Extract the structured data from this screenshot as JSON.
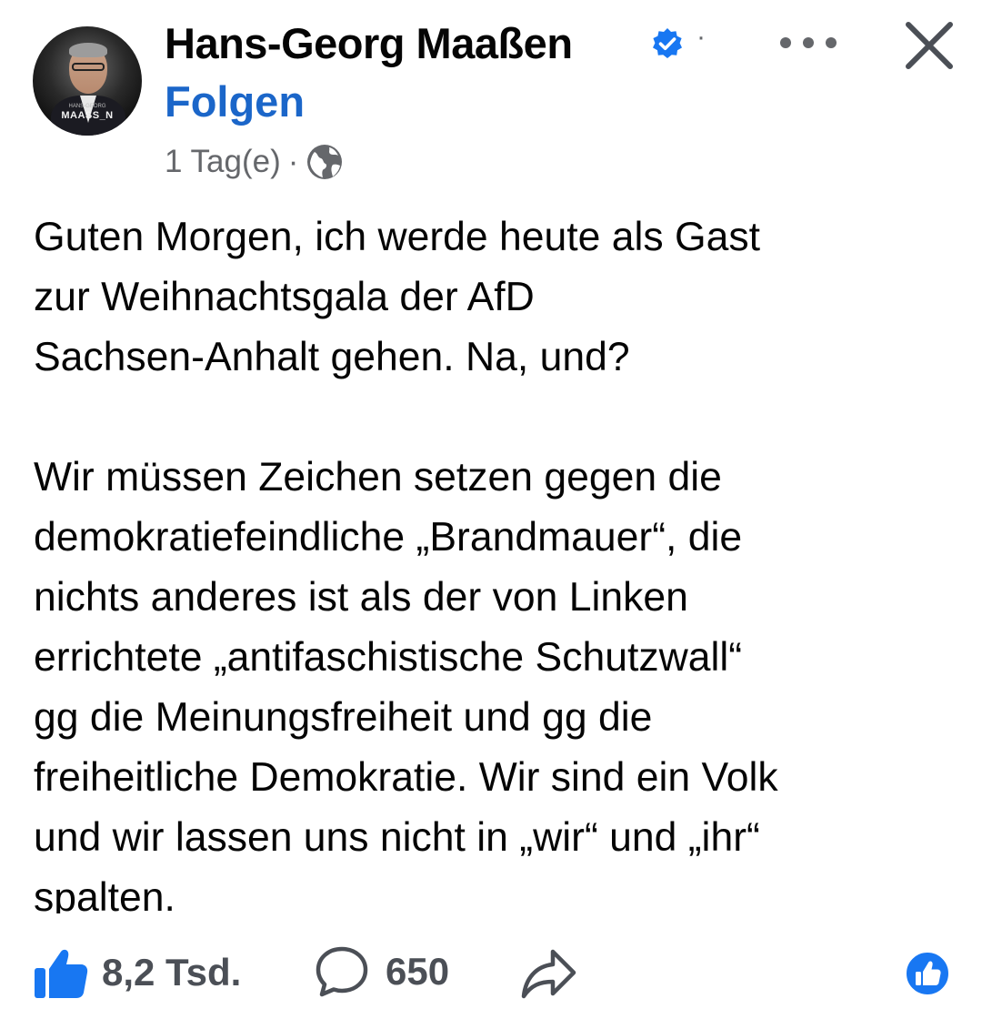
{
  "header": {
    "author_name": "Hans-Georg Maaßen",
    "avatar_brand": "MAASS_N",
    "avatar_brand_small": "HANS-GEORG",
    "follow_label": "Folgen",
    "time_label": "1 Tag(e)",
    "separator": "·",
    "verified": true,
    "privacy_icon": "globe-icon",
    "more_icon": "more-options-icon",
    "close_icon": "close-icon"
  },
  "post": {
    "paragraph_1": "Guten Morgen, ich werde heute als Gast\nzur Weihnachtsgala der AfD\nSachsen-Anhalt gehen. Na, und?",
    "paragraph_2": "Wir müssen Zeichen setzen gegen die\ndemokratiefeindliche „Brandmauer“, die\nnichts anderes ist als der von Linken\nerrichtete „antifaschistische Schutzwall“\ngg die Meinungsfreiheit und gg die\nfreiheitliche Demokratie. Wir sind ein Volk\nund wir lassen uns nicht in „wir“ und „ihr“\nspalten."
  },
  "footer": {
    "like_count": "8,2 Tsd.",
    "comment_count": "650",
    "like_icon": "thumbs-up-icon",
    "comment_icon": "comment-bubble-icon",
    "share_icon": "share-arrow-icon",
    "reaction_icon": "like-reaction-badge-icon"
  },
  "colors": {
    "accent_blue": "#1b66c9",
    "like_blue": "#1877f2",
    "text": "#050505",
    "secondary_text": "#65676b"
  }
}
